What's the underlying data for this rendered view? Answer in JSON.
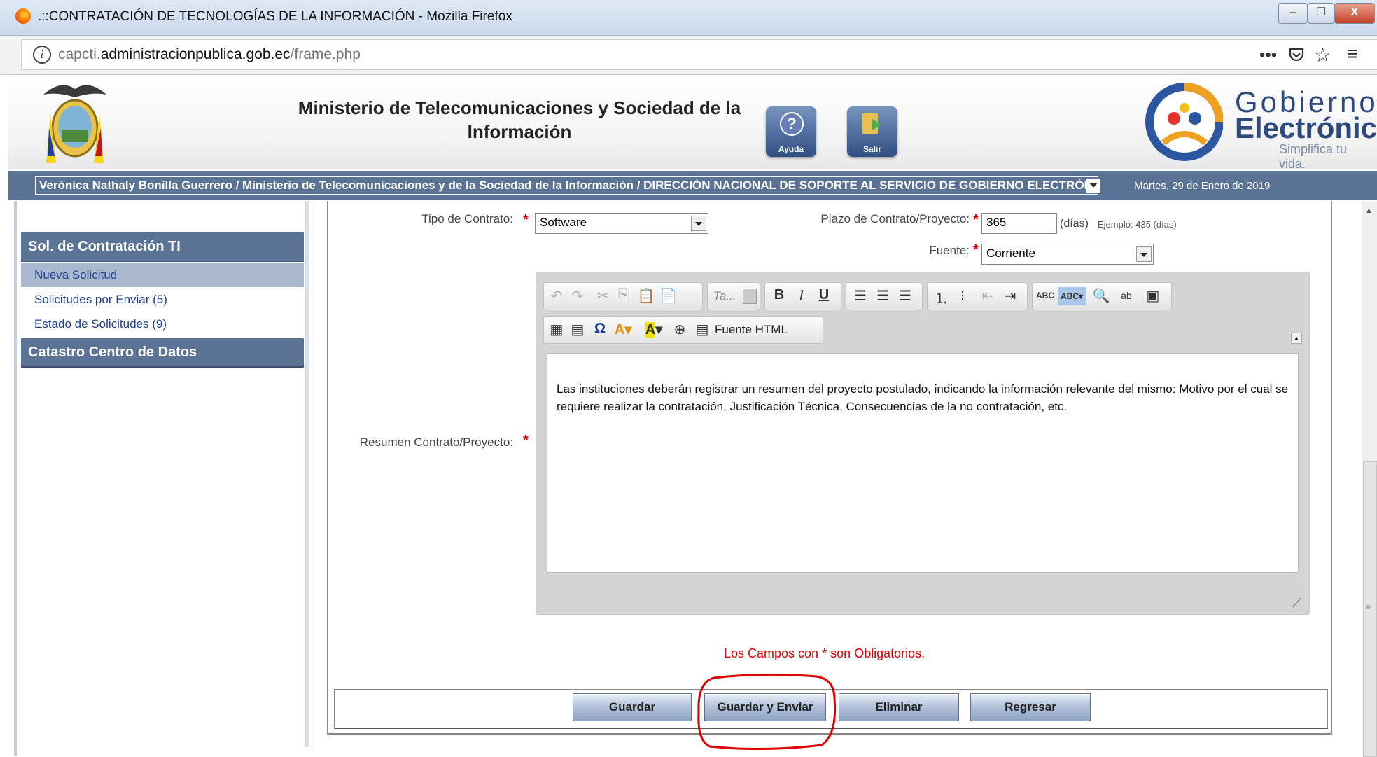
{
  "window": {
    "title": ".::CONTRATACIÓN DE TECNOLOGÍAS DE LA INFORMACIÓN - Mozilla Firefox",
    "minimize": "–",
    "maximize": "☐",
    "close": "X"
  },
  "browser": {
    "url_prefix": "capcti.",
    "url_domain": "administracionpublica.gob.ec",
    "url_path": "/frame.php",
    "icons": [
      "info-icon",
      "more-icon",
      "pocket-icon",
      "bookmark-star-icon",
      "menu-icon"
    ]
  },
  "header": {
    "ministry_title": "Ministerio de Telecomunicaciones y Sociedad de la Información",
    "help_label": "Ayuda",
    "exit_label": "Salir",
    "brand_line1": "Gobierno",
    "brand_line2": "Electrónico",
    "brand_tagline": "Simplifica tu vida."
  },
  "userbar": {
    "user_path": "Verónica Nathaly Bonilla Guerrero / Ministerio de Telecomunicaciones y de la Sociedad de la Información / DIRECCIÓN NACIONAL DE SOPORTE AL SERVICIO DE GOBIERNO ELECTRÓNICO / Analis",
    "date": "Martes, 29 de Enero de 2019"
  },
  "sidebar": {
    "section1": "Sol. de Contratación TI",
    "items": [
      {
        "label": "Nueva Solicitud"
      },
      {
        "label": "Solicitudes por Enviar (5)"
      },
      {
        "label": "Estado de Solicitudes (9)"
      }
    ],
    "section2": "Catastro Centro de Datos"
  },
  "form": {
    "tipo_label": "Tipo de Contrato:",
    "tipo_value": "Software",
    "plazo_label": "Plazo de Contrato/Proyecto:",
    "plazo_value": "365",
    "plazo_unit": "(días)",
    "plazo_example": "Ejemplo: 435 (días)",
    "fuente_label": "Fuente:",
    "fuente_value": "Corriente",
    "resumen_label": "Resumen Contrato/Proyecto:",
    "required_mark": "*",
    "resumen_text": "Las instituciones deberán registrar un resumen del proyecto postulado, indicando la información relevante del mismo: Motivo por el cual se requiere realizar la contratación, Justificación Técnica, Consecuencias de la no contratación, etc.",
    "required_note": "Los Campos con * son Obligatorios."
  },
  "editor": {
    "font_placeholder": "Ta...",
    "source_label": "Fuente HTML"
  },
  "buttons": {
    "guardar": "Guardar",
    "guardar_enviar": "Guardar y Enviar",
    "eliminar": "Eliminar",
    "regresar": "Regresar"
  },
  "colors": {
    "accent_blue": "#5b7394",
    "required_red": "#dd0000",
    "highlight_circle": "#e00000"
  }
}
